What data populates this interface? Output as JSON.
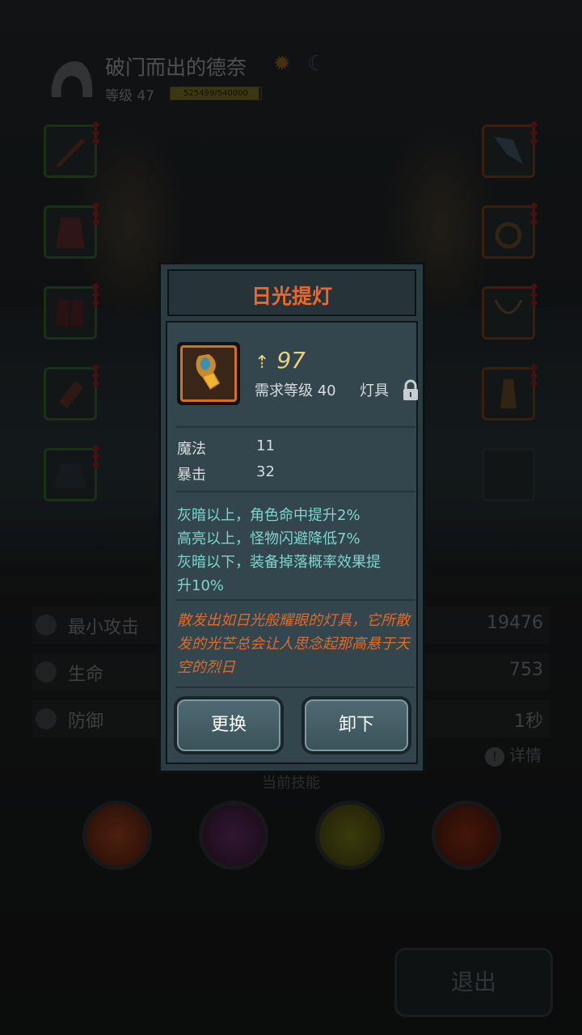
{
  "player": {
    "name": "破门而出的德奈",
    "level_label": "等级 47",
    "xp_text": "525499/540000",
    "xp_progress": 0.973
  },
  "stats": [
    {
      "label": "最小攻击",
      "value": "19476",
      "icon": "sword-icon"
    },
    {
      "label": "生命",
      "value": "753",
      "icon": "heart-icon"
    },
    {
      "label": "防御",
      "value": "1秒",
      "icon": "armor-icon"
    }
  ],
  "detail_label": "详情",
  "skills_title": "当前技能",
  "exit_label": "退出",
  "dialog": {
    "title": "日光提灯",
    "power": "97",
    "required_level": "需求等级 40",
    "item_type": "灯具",
    "attributes": [
      {
        "name": "魔法",
        "value": "11"
      },
      {
        "name": "暴击",
        "value": "32"
      }
    ],
    "effects": [
      "灰暗以上，角色命中提升2%",
      "高亮以上，怪物闪避降低7%",
      "灰暗以下，装备掉落概率效果提",
      "升10%"
    ],
    "lore": "散发出如日光般耀眼的灯具，它所散发的光芒总会让人思念起那高悬于天空的烈日",
    "buttons": {
      "replace": "更换",
      "unequip": "卸下"
    }
  },
  "colors": {
    "title": "#f0662a",
    "effects": "#7fd3cf",
    "lore": "#e06a2a",
    "power": "#e8d27a",
    "frame_orange": "#d0731c"
  }
}
